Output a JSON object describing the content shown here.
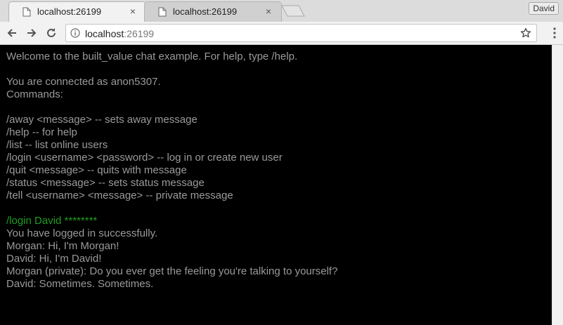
{
  "browser": {
    "tabs": [
      {
        "title": "localhost:26199",
        "active": true,
        "close": "×"
      },
      {
        "title": "localhost:26199",
        "active": false,
        "close": "×"
      }
    ],
    "profile_name": "David",
    "url_host": "localhost",
    "url_port": ":26199"
  },
  "chat": {
    "lines": [
      {
        "text": "Welcome to the built_value chat example. For help, type /help.",
        "style": "normal"
      },
      {
        "text": "",
        "style": "normal"
      },
      {
        "text": "You are connected as anon5307.",
        "style": "normal"
      },
      {
        "text": "Commands:",
        "style": "normal"
      },
      {
        "text": "",
        "style": "normal"
      },
      {
        "text": "/away <message> -- sets away message",
        "style": "normal"
      },
      {
        "text": "/help -- for help",
        "style": "normal"
      },
      {
        "text": "/list -- list online users",
        "style": "normal"
      },
      {
        "text": "/login <username> <password> -- log in or create new user",
        "style": "normal"
      },
      {
        "text": "/quit <message> -- quits with message",
        "style": "normal"
      },
      {
        "text": "/status <message> -- sets status message",
        "style": "normal"
      },
      {
        "text": "/tell <username> <message> -- private message",
        "style": "normal"
      },
      {
        "text": "",
        "style": "normal"
      },
      {
        "text": "/login David ********",
        "style": "green"
      },
      {
        "text": "You have logged in successfully.",
        "style": "normal"
      },
      {
        "text": "Morgan: Hi, I'm Morgan!",
        "style": "normal"
      },
      {
        "text": "David: Hi, I'm David!",
        "style": "normal"
      },
      {
        "text": "Morgan (private): Do you ever get the feeling you're talking to yourself?",
        "style": "normal"
      },
      {
        "text": "David: Sometimes. Sometimes.",
        "style": "normal"
      }
    ]
  },
  "colors": {
    "background": "#000000",
    "text": "#9a9a9a",
    "command_echo": "#1f9e1f"
  }
}
